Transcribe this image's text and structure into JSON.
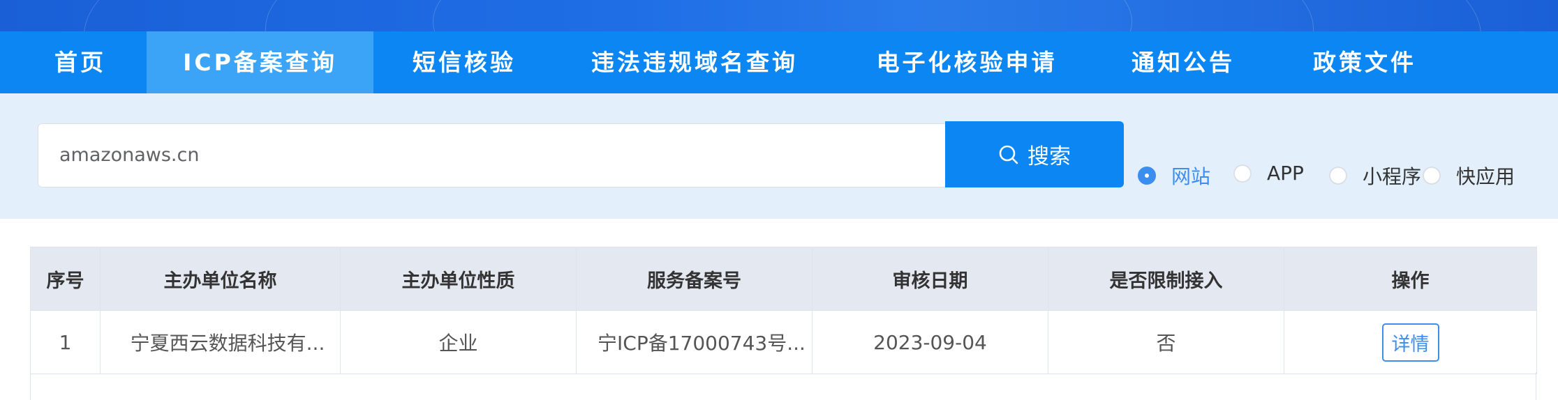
{
  "nav": {
    "items": [
      {
        "label": "首页"
      },
      {
        "label": "ICP备案查询"
      },
      {
        "label": "短信核验"
      },
      {
        "label": "违法违规域名查询"
      },
      {
        "label": "电子化核验申请"
      },
      {
        "label": "通知公告"
      },
      {
        "label": "政策文件"
      }
    ],
    "active": "ICP备案查询"
  },
  "search": {
    "value": "amazonaws.cn",
    "button_label": "搜索",
    "button_icon": "search-icon"
  },
  "types": {
    "options": [
      {
        "label": "网站",
        "checked": true
      },
      {
        "label": "APP",
        "checked": false
      },
      {
        "label": "小程序",
        "checked": false
      },
      {
        "label": "快应用",
        "checked": false
      }
    ]
  },
  "table": {
    "headers": [
      "序号",
      "主办单位名称",
      "主办单位性质",
      "服务备案号",
      "审核日期",
      "是否限制接入",
      "操作"
    ],
    "rows": [
      {
        "index": "1",
        "org_name": "宁夏西云数据科技有...",
        "org_type": "企业",
        "license": "宁ICP备17000743号...",
        "date": "2023-09-04",
        "restricted": "否",
        "action": "详情"
      }
    ]
  },
  "colors": {
    "banner": "#1a5fd6",
    "nav_bg": "#0c86f3",
    "nav_active": "#3ca4f6",
    "search_band": "#e3f0fc",
    "accent": "#3b8ef0",
    "table_header": "#e4e8f1"
  }
}
